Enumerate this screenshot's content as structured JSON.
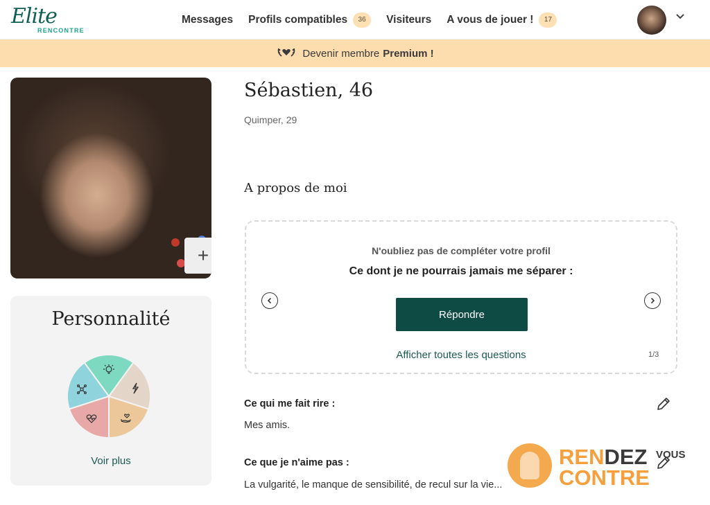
{
  "brand": {
    "logo_script": "Elite",
    "logo_sub": "RENCONTRE"
  },
  "nav": {
    "messages": "Messages",
    "profils": "Profils compatibles",
    "profils_badge": "36",
    "visiteurs": "Visiteurs",
    "jouer": "A vous de jouer !",
    "jouer_badge": "17"
  },
  "banner": {
    "text": "Devenir membre",
    "bold": "Premium !"
  },
  "profile": {
    "name": "Sébastien, 46",
    "location": "Quimper, 29",
    "add_photo": "+"
  },
  "personnalite": {
    "title": "Personnalité",
    "more": "Voir plus",
    "slices": [
      {
        "icon": "lightbulb-icon",
        "color": "#7dd9c0"
      },
      {
        "icon": "lightning-icon",
        "color": "#e3d6c8"
      },
      {
        "icon": "hand-heart-icon",
        "color": "#ecc79a"
      },
      {
        "icon": "heartbeat-icon",
        "color": "#e8a8a8"
      },
      {
        "icon": "network-icon",
        "color": "#8fd3dc"
      }
    ]
  },
  "about": {
    "title": "A propos de moi",
    "hint": "N'oubliez pas de compléter votre profil",
    "question": "Ce dont je ne pourrais jamais me séparer :",
    "answer_btn": "Répondre",
    "all_questions": "Afficher toutes les questions",
    "counter": "1/3"
  },
  "sections": {
    "rire_label": "Ce qui me fait rire :",
    "rire_value": "Mes amis.",
    "aime_pas_label": "Ce que je n'aime pas :",
    "aime_pas_value": "La vulgarité, le manque de sensibilité, de recul sur la vie..."
  },
  "watermark": {
    "line1_orange": "REN",
    "line1_dark": "DEZ",
    "line1_small": "VOUS",
    "line2": "CONTRE"
  },
  "colors": {
    "accent_dark_green": "#0e4b45",
    "link_green": "#1a5a52",
    "banner_bg": "#fddcae",
    "badge_bg": "#fde0b4"
  }
}
